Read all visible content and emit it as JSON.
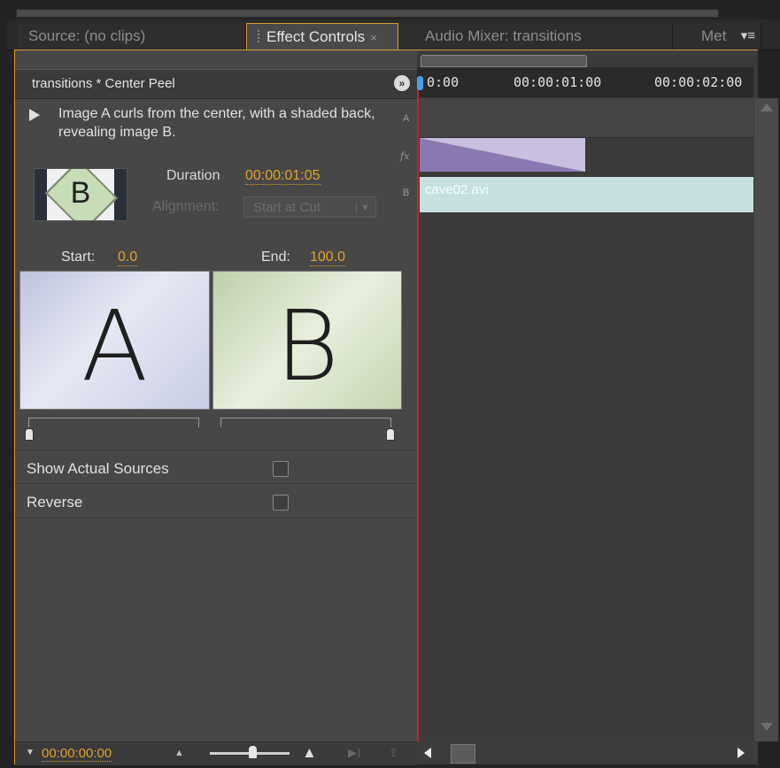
{
  "tabs": [
    {
      "label": "Source: (no clips)"
    },
    {
      "label": "Effect Controls",
      "active": true
    },
    {
      "label": "Audio Mixer: transitions"
    },
    {
      "label": "Met"
    }
  ],
  "header": {
    "title": "transitions * Center Peel"
  },
  "effect": {
    "description": "Image A curls from the center, with a shaded back, revealing image B.",
    "thumbnail_letter": "B",
    "duration_label": "Duration",
    "duration_value": "00:00:01:05",
    "alignment_label": "Alignment:",
    "alignment_value": "Start at Cut"
  },
  "start_end": {
    "start_label": "Start:",
    "start_value": "0.0",
    "end_label": "End:",
    "end_value": "100.0",
    "image_a": "A",
    "image_b": "B"
  },
  "options": {
    "show_actual_sources": "Show Actual Sources",
    "reverse": "Reverse"
  },
  "timeline": {
    "ticks": [
      "0:00",
      "00:00:01:00",
      "00:00:02:00"
    ],
    "track_a": "A",
    "track_fx": "fx",
    "track_b": "B",
    "clip_b": "cave02.avi"
  },
  "footer": {
    "timecode": "00:00:00:00"
  },
  "colors": {
    "accent": "#e3a329",
    "playhead": "#c0262b",
    "clip_b": "#c5e0df",
    "transition": "#8a79b0"
  }
}
